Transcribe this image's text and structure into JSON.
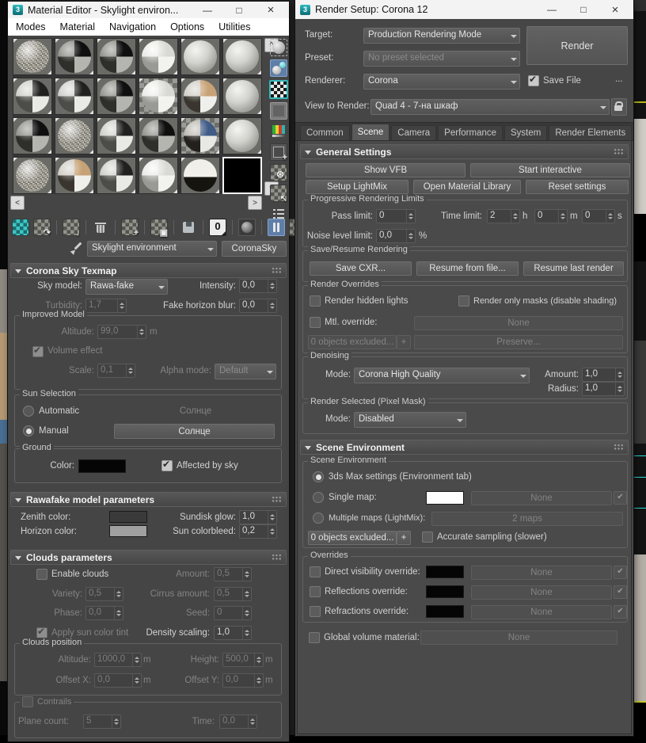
{
  "app": {
    "accent_blue": "#5f7ea8",
    "teal": "#35b8bc",
    "min": "—",
    "max": "□",
    "close": "×"
  },
  "material_editor": {
    "title": "Material Editor - Skylight environ...",
    "icon_label": "3",
    "menus": [
      "Modes",
      "Material",
      "Navigation",
      "Options",
      "Utilities"
    ],
    "slots": [
      {
        "kind": "v-speck"
      },
      {
        "kind": "v-chkd"
      },
      {
        "kind": "v-chkd"
      },
      {
        "kind": "v-chkl"
      },
      {
        "kind": "v-plain"
      },
      {
        "kind": "v-plain"
      },
      {
        "kind": "v-chk"
      },
      {
        "kind": "v-chk"
      },
      {
        "kind": "v-chkd"
      },
      {
        "kind": "v-chkl tbg"
      },
      {
        "kind": "v-tan"
      },
      {
        "kind": "v-plain"
      },
      {
        "kind": "v-chkd"
      },
      {
        "kind": "v-speck"
      },
      {
        "kind": "v-chk"
      },
      {
        "kind": "v-chkd"
      },
      {
        "kind": "v-blue tbg"
      },
      {
        "kind": "v-plain"
      },
      {
        "kind": "v-speck"
      },
      {
        "kind": "v-tan"
      },
      {
        "kind": "v-chk"
      },
      {
        "kind": "v-chkl"
      },
      {
        "kind": "v-dome"
      },
      {
        "kind": "v-black",
        "selected": true
      }
    ],
    "scroll": {
      "up": "^",
      "down": "v",
      "left": "<",
      "right": ">"
    },
    "side_toolbar": [
      {
        "name": "sample-type-icon",
        "kind": "k-circle"
      },
      {
        "name": "sample-spheres-icon",
        "kind": "k-spheres",
        "active": true
      },
      {
        "name": "background-icon",
        "kind": "k-bgchecker"
      },
      {
        "name": "backlight-icon",
        "kind": "k-square"
      },
      {
        "name": "sample-uv-tiling-icon",
        "kind": "k-bars"
      },
      {
        "name": "make-preview-icon",
        "kind": "k-film",
        "glyph": "+"
      },
      {
        "name": "options-icon",
        "kind": "k-gear",
        "glyph": "⊛"
      },
      {
        "name": "select-by-material-icon",
        "kind": "k-pick",
        "glyph": "↖"
      },
      {
        "name": "material-map-navigator-icon",
        "kind": "k-nav"
      }
    ],
    "main_toolbar": [
      {
        "name": "get-material-icon",
        "kind": "k-getmat"
      },
      {
        "name": "put-material-to-scene-icon",
        "kind": "k-putscene",
        "glyph": "↷"
      },
      {
        "kind": "divider"
      },
      {
        "name": "assign-material-to-selection-icon",
        "kind": "k-assign",
        "glyph": "↓"
      },
      {
        "kind": "divider"
      },
      {
        "name": "reset-to-default-icon",
        "kind": "k-trash"
      },
      {
        "kind": "divider"
      },
      {
        "name": "make-material-copy-icon",
        "kind": "k-copy",
        "glyph": "+"
      },
      {
        "kind": "divider"
      },
      {
        "name": "make-unique-icon",
        "kind": "k-unique",
        "glyph": "▣"
      },
      {
        "kind": "divider"
      },
      {
        "name": "put-to-library-icon",
        "kind": "k-floppy"
      },
      {
        "kind": "divider"
      },
      {
        "name": "material-id-channel-icon",
        "kind": "k-id0",
        "label": "0"
      },
      {
        "kind": "divider"
      },
      {
        "name": "show-material-in-viewport-icon",
        "kind": "k-vp"
      },
      {
        "kind": "divider"
      },
      {
        "name": "show-end-result-icon",
        "kind": "k-end",
        "active": true
      },
      {
        "name": "go-to-parent-icon",
        "kind": "k-parent",
        "glyph": "↑"
      },
      {
        "name": "go-forward-to-sibling-icon",
        "kind": "k-sibling",
        "glyph": "→"
      }
    ],
    "picker": {
      "slot_name": "Skylight environment",
      "type_button": "CoronaSky"
    },
    "sky": {
      "rollout": "Corona Sky Texmap",
      "sky_model_label": "Sky model:",
      "sky_model_value": "Rawa-fake",
      "intensity_label": "Intensity:",
      "intensity_value": "0,0",
      "turbidity_label": "Turbidity:",
      "turbidity_value": "1,7",
      "fake_blur_label": "Fake horizon blur:",
      "fake_blur_value": "0,0",
      "improved": {
        "label": "Improved Model",
        "altitude_label": "Altitude:",
        "altitude_value": "99,0",
        "unit_m": "m",
        "volume_label": "Volume effect",
        "scale_label": "Scale:",
        "scale_value": "0,1",
        "alpha_label": "Alpha mode:",
        "alpha_value": "Default"
      },
      "sun": {
        "label": "Sun Selection",
        "auto_label": "Automatic",
        "auto_value": "Солнце",
        "manual_label": "Manual",
        "manual_value": "Солнце"
      },
      "ground": {
        "label": "Ground",
        "color_label": "Color:",
        "affected_label": "Affected by sky"
      }
    },
    "rawafake": {
      "rollout": "Rawafake model parameters",
      "zenith_label": "Zenith color:",
      "horizon_label": "Horizon color:",
      "sundisk_label": "Sundisk glow:",
      "sundisk_value": "1,0",
      "colorbleed_label": "Sun colorbleed:",
      "colorbleed_value": "0,2",
      "zenith_color": "#3a3a3a",
      "horizon_color": "#a0a0a0"
    },
    "clouds": {
      "rollout": "Clouds parameters",
      "enable_label": "Enable clouds",
      "amount_label": "Amount:",
      "amount_value": "0,5",
      "variety_label": "Variety:",
      "variety_value": "0,5",
      "cirrus_label": "Cirrus amount:",
      "cirrus_value": "0,5",
      "phase_label": "Phase:",
      "phase_value": "0,0",
      "seed_label": "Seed:",
      "seed_value": "0",
      "tint_label": "Apply sun color tint",
      "density_label": "Density scaling:",
      "density_value": "1,0",
      "position": {
        "label": "Clouds position",
        "altitude_label": "Altitude:",
        "altitude_value": "1000,0",
        "height_label": "Height:",
        "height_value": "500,0",
        "offsetx_label": "Offset X:",
        "offsetx_value": "0,0",
        "offsety_label": "Offset Y:",
        "offsety_value": "0,0",
        "unit_m": "m"
      },
      "contrails": {
        "label": "Contrails",
        "plane_label": "Plane count:",
        "plane_value": "5",
        "time_label": "Time:",
        "time_value": "0,0"
      }
    }
  },
  "render_setup": {
    "title": "Render Setup: Corona 12",
    "icon_label": "3",
    "target_label": "Target:",
    "target_value": "Production Rendering Mode",
    "preset_label": "Preset:",
    "preset_value": "No preset selected",
    "renderer_label": "Renderer:",
    "renderer_value": "Corona",
    "save_file_label": "Save File",
    "more_button": "...",
    "render_button": "Render",
    "view_label": "View to Render:",
    "view_value": "Quad 4 - 7-на шкаф",
    "tabs": [
      "Common",
      "Scene",
      "Camera",
      "Performance",
      "System",
      "Render Elements"
    ],
    "active_tab": "Scene",
    "general": {
      "rollout": "General Settings",
      "show_vfb": "Show VFB",
      "start_interactive": "Start interactive",
      "setup_lightmix": "Setup LightMix",
      "open_matlib": "Open Material Library",
      "reset_settings": "Reset settings",
      "limits": {
        "label": "Progressive Rendering Limits",
        "pass_label": "Pass limit:",
        "pass_value": "0",
        "time_label": "Time limit:",
        "h_value": "2",
        "h": "h",
        "m_value": "0",
        "m": "m",
        "s_value": "0",
        "s": "s",
        "noise_label": "Noise level limit:",
        "noise_value": "0,0",
        "pct": "%"
      },
      "save_resume": {
        "label": "Save/Resume Rendering",
        "save_cxr": "Save CXR...",
        "resume_file": "Resume from file...",
        "resume_last": "Resume last render"
      },
      "overrides": {
        "label": "Render Overrides",
        "hidden_lights": "Render hidden lights",
        "only_masks": "Render only masks (disable shading)",
        "mtl_override": "Mtl. override:",
        "none": "None",
        "excluded": "0 objects excluded...",
        "plus": "+",
        "preserve": "Preserve..."
      },
      "denoising": {
        "label": "Denoising",
        "mode_label": "Mode:",
        "mode_value": "Corona High Quality",
        "amount_label": "Amount:",
        "amount_value": "1,0",
        "radius_label": "Radius:",
        "radius_value": "1,0"
      },
      "render_selected": {
        "label": "Render Selected (Pixel Mask)",
        "mode_label": "Mode:",
        "mode_value": "Disabled"
      }
    },
    "scene_env": {
      "rollout": "Scene Environment",
      "group_label": "Scene Environment",
      "max_settings": "3ds Max settings (Environment tab)",
      "single_map": "Single map:",
      "none": "None",
      "check": "✔",
      "multiple_maps": "Multiple maps (LightMix):",
      "maps_value": "2 maps",
      "excluded": "0 objects excluded...",
      "plus": "+",
      "accurate": "Accurate sampling (slower)",
      "overrides": {
        "label": "Overrides",
        "rows": [
          "Direct visibility override:",
          "Reflections override:",
          "Refractions override:"
        ],
        "none": "None",
        "check": "✔"
      },
      "global_label": "Global volume material:"
    }
  }
}
